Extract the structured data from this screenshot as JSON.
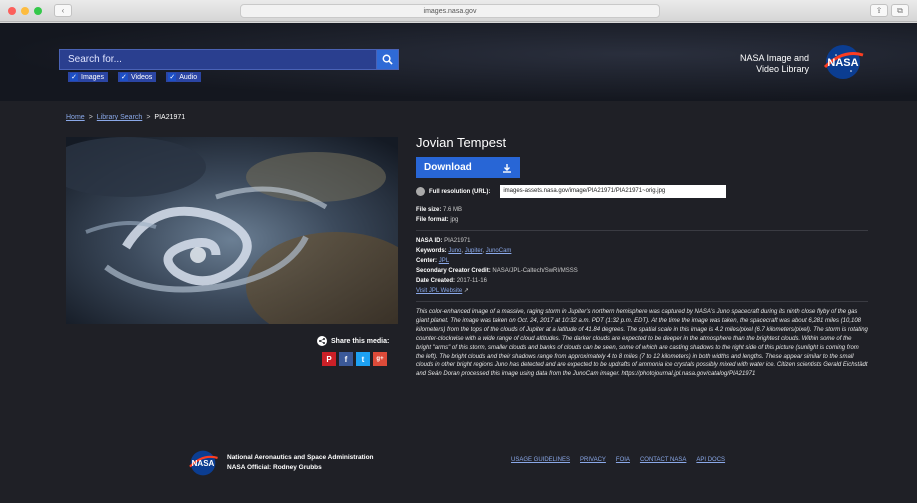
{
  "browser": {
    "url": "images.nasa.gov"
  },
  "header": {
    "search_placeholder": "Search for...",
    "filters": [
      "Images",
      "Videos",
      "Audio"
    ],
    "brand_line1": "NASA Image and",
    "brand_line2": "Video Library",
    "logo_text": "NASA"
  },
  "breadcrumb": {
    "home": "Home",
    "search": "Library Search",
    "current": "PIA21971",
    "sep": ">"
  },
  "share": {
    "label": "Share this media:",
    "icons": [
      "P",
      "f",
      "t",
      "g+"
    ]
  },
  "details": {
    "title": "Jovian Tempest",
    "download_label": "Download",
    "fullres_label": "Full resolution (URL):",
    "fullres_url": "images-assets.nasa.gov/image/PIA21971/PIA21971~orig.jpg",
    "file_size_label": "File size:",
    "file_size": "7.6 MB",
    "file_format_label": "File format:",
    "file_format": "jpg",
    "nasa_id_label": "NASA ID:",
    "nasa_id": "PIA21971",
    "keywords_label": "Keywords:",
    "keywords": [
      "Juno",
      "Jupiter",
      "JunoCam"
    ],
    "center_label": "Center:",
    "center": "JPL",
    "credit_label": "Secondary Creator Credit:",
    "credit": "NASA/JPL-Caltech/SwRI/MSSS",
    "date_label": "Date Created:",
    "date": "2017-11-16",
    "visit_link": "Visit JPL Website",
    "description": "This color-enhanced image of a massive, raging storm in Jupiter's northern hemisphere was captured by NASA's Juno spacecraft during its ninth close flyby of the gas giant planet. The image was taken on Oct. 24, 2017 at 10:32 a.m. PDT (1:32 p.m. EDT). At the time the image was taken, the spacecraft was about 6,281 miles (10,108 kilometers) from the tops of the clouds of Jupiter at a latitude of 41.84 degrees. The spatial scale in this image is 4.2 miles/pixel (6.7 kilometers/pixel). The storm is rotating counter-clockwise with a wide range of cloud altitudes. The darker clouds are expected to be deeper in the atmosphere than the brightest clouds. Within some of the bright \"arms\" of this storm, smaller clouds and banks of clouds can be seen, some of which are casting shadows to the right side of this picture (sunlight is coming from the left). The bright clouds and their shadows range from approximately 4 to 8 miles (7 to 12 kilometers) in both widths and lengths. These appear similar to the small clouds in other bright regions Juno has detected and are expected to be updrafts of ammonia ice crystals possibly mixed with water ice. Citizen scientists Gerald Eichstädt and Seán Doran processed this image using data from the JunoCam imager. https://photojournal.jpl.nasa.gov/catalog/PIA21971"
  },
  "footer": {
    "org_name": "National Aeronautics and Space Administration",
    "official_label": "NASA Official:",
    "official_name": "Rodney Grubbs",
    "links": [
      "USAGE GUIDELINES",
      "PRIVACY",
      "FOIA",
      "CONTACT NASA",
      "API DOCS"
    ]
  },
  "colors": {
    "accent": "#2866d6",
    "link": "#8aa8e8",
    "background": "#1f2026"
  }
}
